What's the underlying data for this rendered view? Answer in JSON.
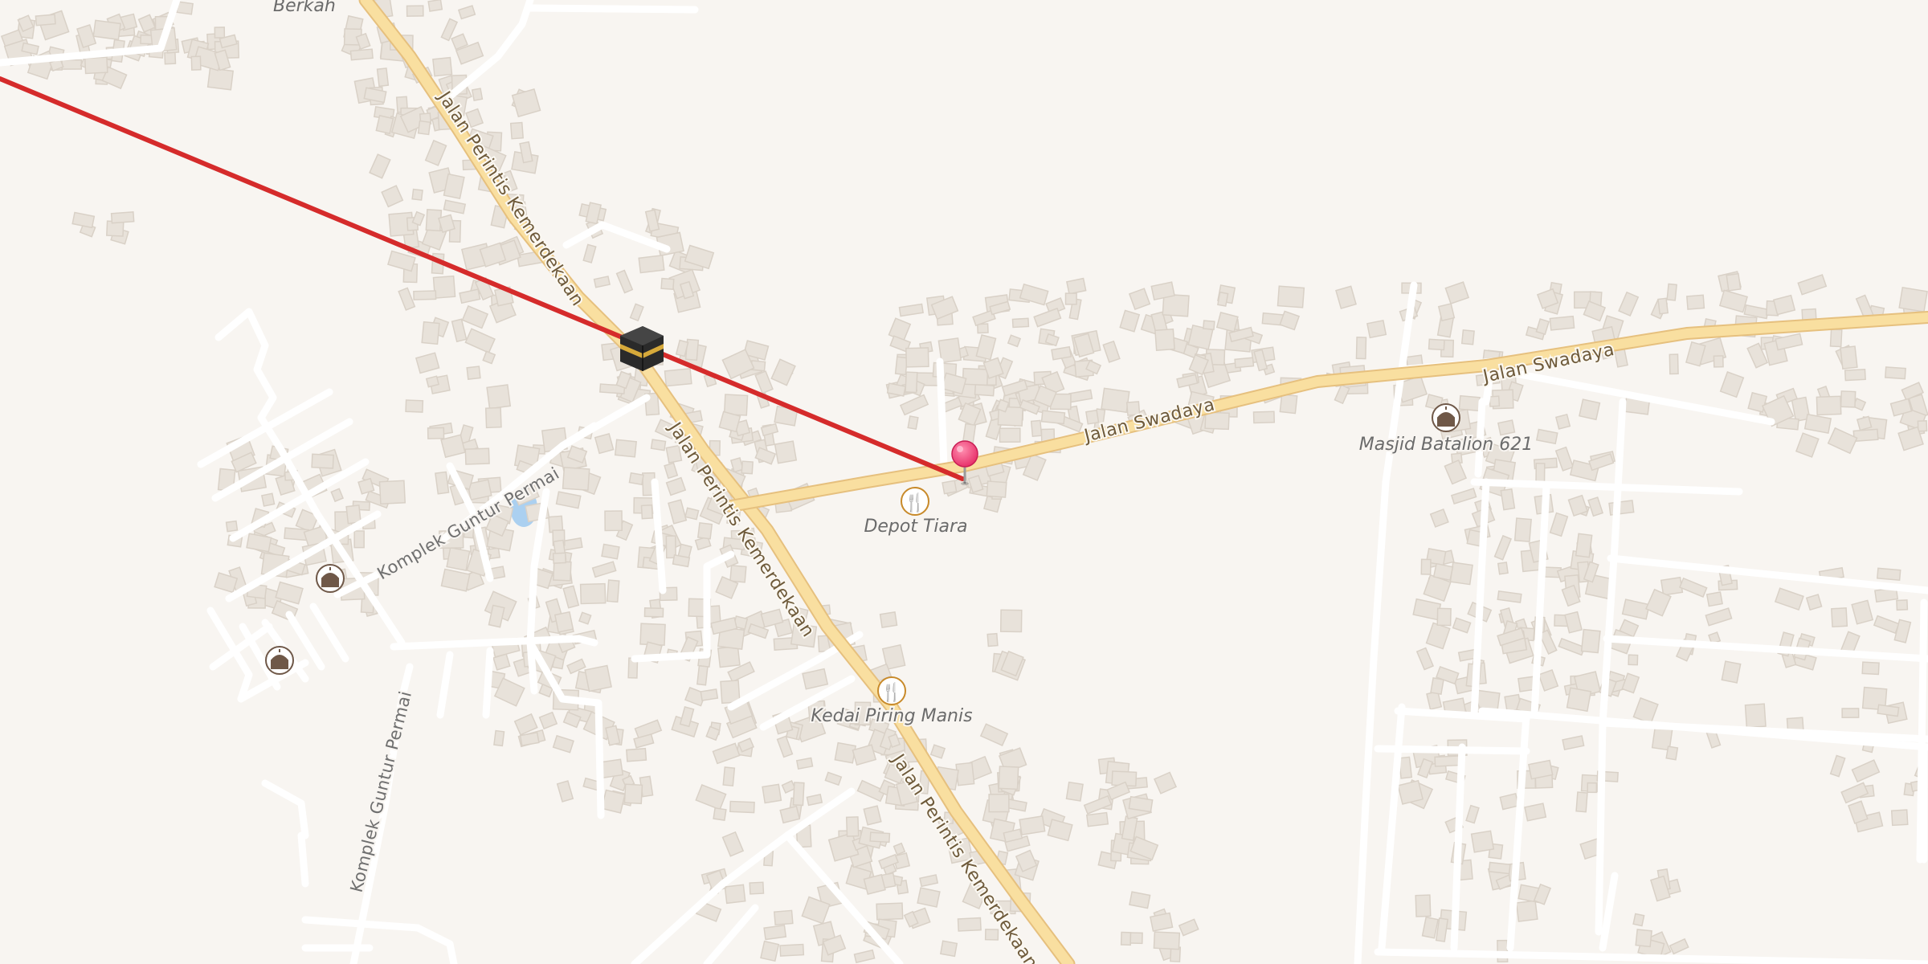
{
  "map": {
    "roads": {
      "primary": "Jalan Perintis Kemerdekaan",
      "secondary": "Jalan Swadaya",
      "residential": "Komplek Guntur Permai"
    },
    "places": {
      "top_clipped": "Berkah"
    },
    "pois": [
      {
        "name": "Depot Tiara",
        "icon": "restaurant-icon"
      },
      {
        "name": "Kedai Piring Manis",
        "icon": "restaurant-icon"
      },
      {
        "name": "Masjid Batalion 621",
        "icon": "mosque-icon"
      }
    ],
    "unlabeled_pois": [
      {
        "icon": "mosque-icon"
      },
      {
        "icon": "mosque-icon"
      }
    ],
    "markers": {
      "kaaba": {
        "icon": "kaaba-icon"
      },
      "location_pin": {
        "icon": "map-pin-icon",
        "color": "#e8336c"
      }
    },
    "qibla_line": {
      "color": "#d52b2b"
    },
    "colors": {
      "background": "#f8f5f1",
      "building": "#e8e2da",
      "primary_road": "#f9dfa0",
      "minor_road": "#ffffff",
      "water": "#abd0f0",
      "poi_restaurant": "#c88a2a",
      "poi_mosque": "#6f5848"
    }
  }
}
